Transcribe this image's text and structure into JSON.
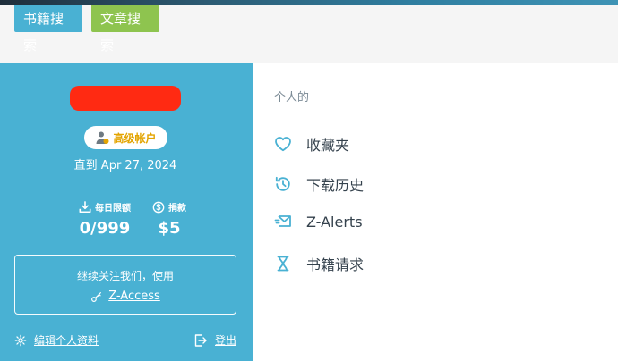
{
  "top": {
    "tabs": [
      {
        "label": "书籍搜索",
        "color": "#49b1d3"
      },
      {
        "label": "文章搜索",
        "color": "#8ec44f"
      }
    ]
  },
  "left_panel": {
    "accent": "#49b1d3",
    "badge": {
      "icon": "user-badge-icon",
      "label": "高级帐户",
      "color": "#e3a400"
    },
    "until_text": "直到 Apr 27, 2024",
    "stats": [
      {
        "icon": "download-icon",
        "label": "每日限额",
        "value": "0/999"
      },
      {
        "icon": "donation-icon",
        "label": "捐款",
        "value": "$5"
      }
    ],
    "follow": {
      "text": "继续关注我们，使用",
      "link_label": "Z-Access",
      "link_icon": "key-icon"
    },
    "edit_profile": {
      "icon": "gear-icon",
      "label": "编辑个人资料"
    },
    "logout": {
      "icon": "logout-icon",
      "label": "登出"
    }
  },
  "right_panel": {
    "section_label": "个人的",
    "menu": [
      {
        "icon": "heart-icon",
        "label": "收藏夹"
      },
      {
        "icon": "history-icon",
        "label": "下载历史"
      },
      {
        "icon": "mail-icon",
        "label": "Z-Alerts"
      },
      {
        "icon": "hourglass-icon",
        "label": "书籍请求"
      }
    ],
    "icon_color": "#49b1d3"
  }
}
